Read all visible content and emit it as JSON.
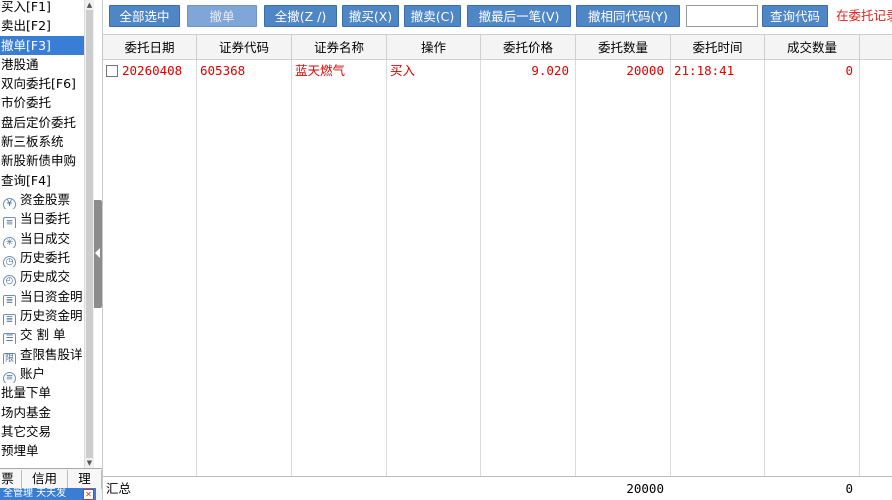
{
  "sidebar": {
    "items": [
      {
        "label": "买入[F1]"
      },
      {
        "label": "卖出[F2]"
      },
      {
        "label": "撤单[F3]",
        "selected": true
      },
      {
        "label": "港股通"
      },
      {
        "label": "双向委托[F6]"
      },
      {
        "label": "市价委托"
      },
      {
        "label": "盘后定价委托"
      },
      {
        "label": "新三板系统"
      },
      {
        "label": "新股新债申购"
      },
      {
        "label": "查询[F4]"
      }
    ],
    "query_items": [
      {
        "label": "资金股票",
        "icon": "money-icon"
      },
      {
        "label": "当日委托",
        "icon": "document-icon"
      },
      {
        "label": "当日成交",
        "icon": "deal-icon"
      },
      {
        "label": "历史委托",
        "icon": "history-icon"
      },
      {
        "label": "历史成交",
        "icon": "history-deal-icon"
      },
      {
        "label": "当日资金明",
        "icon": "statement-icon"
      },
      {
        "label": "历史资金明",
        "icon": "statement-icon"
      },
      {
        "label": "交 割 单",
        "icon": "list-icon"
      },
      {
        "label": "查限售股详",
        "icon": "restricted-icon"
      },
      {
        "label": "账户",
        "icon": "account-icon"
      }
    ],
    "bottom_items": [
      {
        "label": "批量下单"
      },
      {
        "label": "场内基金"
      },
      {
        "label": "其它交易"
      },
      {
        "label": "预埋单"
      }
    ],
    "tabs": [
      "票",
      "信用",
      "理"
    ],
    "status_text": "全管理 天天发"
  },
  "toolbar": {
    "select_all": "全部选中",
    "cancel_order": "撤单",
    "cancel_all": "全撤(Z /)",
    "cancel_buy": "撤买(X)",
    "cancel_sell": "撤卖(C)",
    "cancel_last": "撤最后一笔(V)",
    "cancel_same_code": "撤相同代码(Y)",
    "code_value": "",
    "query_code": "查询代码",
    "hint": "在委托记录上"
  },
  "table": {
    "headers": [
      "委托日期",
      "证券代码",
      "证券名称",
      "操作",
      "委托价格",
      "委托数量",
      "委托时间",
      "成交数量"
    ],
    "rows": [
      {
        "date": "20260408",
        "code": "605368",
        "name": "蓝天燃气",
        "action": "买入",
        "price": "9.020",
        "quantity": "20000",
        "time": "21:18:41",
        "filled": "0"
      }
    ],
    "summary": {
      "label": "汇总",
      "quantity": "20000",
      "filled": "0"
    }
  },
  "colors": {
    "button_bg": "#4f86c6",
    "selected_bg": "#3a7dd4",
    "row_text": "#e00000",
    "hint_text": "#e02020"
  }
}
